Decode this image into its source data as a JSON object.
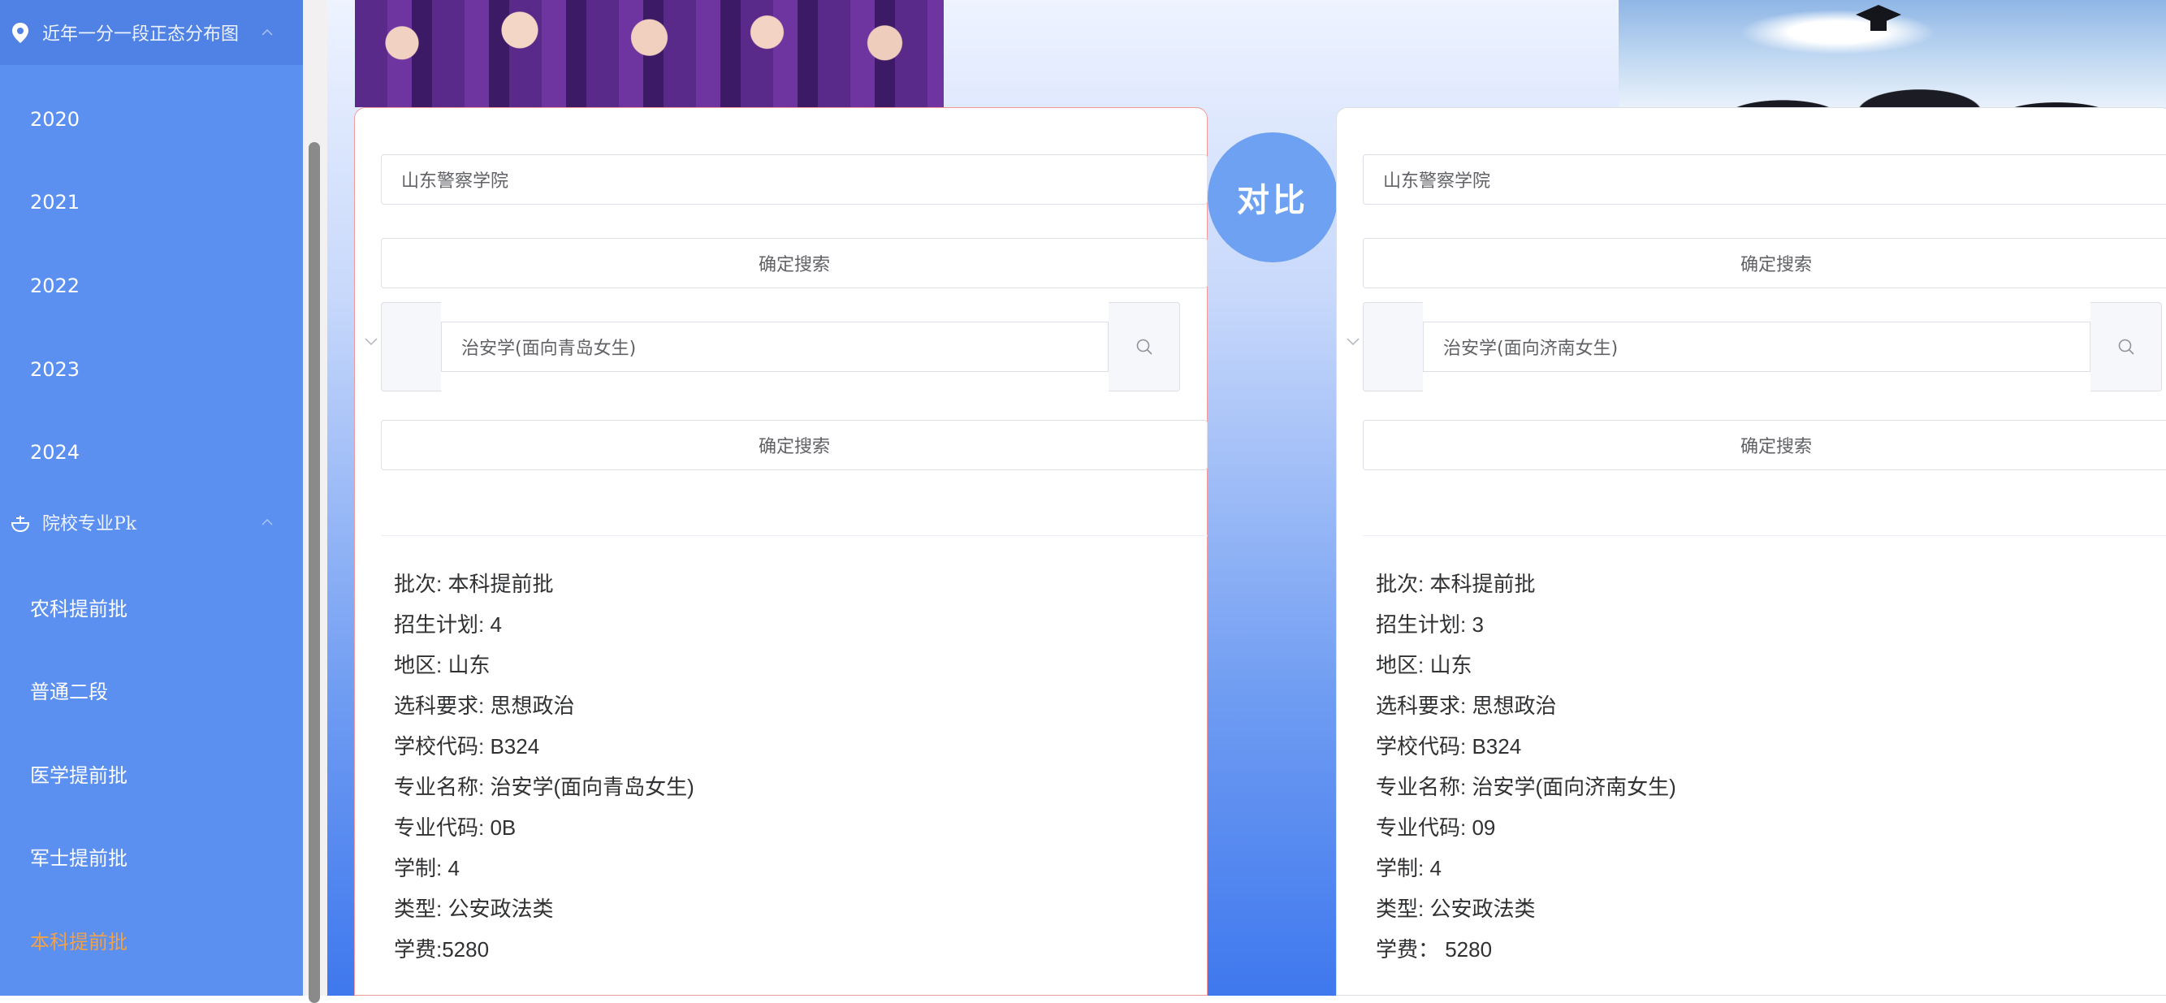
{
  "sidebar": {
    "group1": {
      "label": "近年一分一段正态分布图",
      "icon": "location-pin-icon"
    },
    "years": [
      "2020",
      "2021",
      "2022",
      "2023",
      "2024"
    ],
    "group2": {
      "label": "院校专业Pk",
      "icon": "bowl-icon"
    },
    "batches": [
      "农科提前批",
      "普通二段",
      "医学提前批",
      "军士提前批",
      "本科提前批"
    ],
    "active_batch": "本科提前批"
  },
  "compare": {
    "label": "对比"
  },
  "left": {
    "school_value": "山东警察学院",
    "search_button": "确定搜索",
    "major_value": "治安学(面向青岛女生)",
    "search_button2": "确定搜索",
    "info": [
      "批次: 本科提前批",
      "招生计划: 4",
      "地区: 山东",
      "选科要求: 思想政治",
      "学校代码: B324",
      "专业名称: 治安学(面向青岛女生)",
      "专业代码: 0B",
      "学制: 4",
      "类型: 公安政法类",
      "学费:5280"
    ]
  },
  "right": {
    "school_value": "山东警察学院",
    "search_button": "确定搜索",
    "major_value": "治安学(面向济南女生)",
    "search_button2": "确定搜索",
    "info": [
      "批次: 本科提前批",
      "招生计划: 3",
      "地区: 山东",
      "选科要求: 思想政治",
      "学校代码: B324",
      "专业名称: 治安学(面向济南女生)",
      "专业代码: 09",
      "学制: 4",
      "类型: 公安政法类",
      "学费： 5280"
    ]
  },
  "colors": {
    "sidebar": "#5b8ff0",
    "active": "#f0a24a",
    "compare_circle": "#6ea1f2"
  }
}
